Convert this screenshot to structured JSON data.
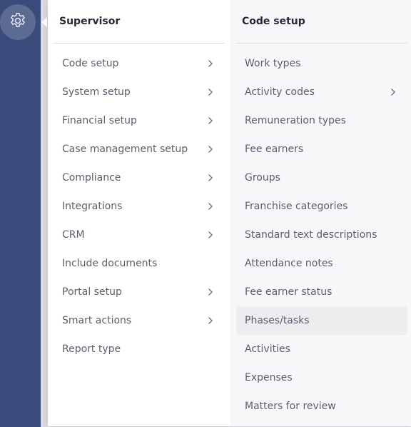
{
  "sidebar": {
    "settings_icon": "gear-icon"
  },
  "left_column": {
    "title": "Supervisor",
    "items": [
      {
        "label": "Code setup",
        "has_submenu": true
      },
      {
        "label": "System setup",
        "has_submenu": true
      },
      {
        "label": "Financial setup",
        "has_submenu": true
      },
      {
        "label": "Case management setup",
        "has_submenu": true
      },
      {
        "label": "Compliance",
        "has_submenu": true
      },
      {
        "label": "Integrations",
        "has_submenu": true
      },
      {
        "label": "CRM",
        "has_submenu": true
      },
      {
        "label": "Include documents",
        "has_submenu": false
      },
      {
        "label": "Portal setup",
        "has_submenu": true
      },
      {
        "label": "Smart actions",
        "has_submenu": true
      },
      {
        "label": "Report type",
        "has_submenu": false
      }
    ]
  },
  "right_column": {
    "title": "Code setup",
    "items": [
      {
        "label": "Work types",
        "has_submenu": false
      },
      {
        "label": "Activity codes",
        "has_submenu": true
      },
      {
        "label": "Remuneration types",
        "has_submenu": false
      },
      {
        "label": "Fee earners",
        "has_submenu": false
      },
      {
        "label": "Groups",
        "has_submenu": false
      },
      {
        "label": "Franchise categories",
        "has_submenu": false
      },
      {
        "label": "Standard text descriptions",
        "has_submenu": false
      },
      {
        "label": "Attendance notes",
        "has_submenu": false
      },
      {
        "label": "Fee earner status",
        "has_submenu": false
      },
      {
        "label": "Phases/tasks",
        "has_submenu": false,
        "hovered": true
      },
      {
        "label": "Activities",
        "has_submenu": false
      },
      {
        "label": "Expenses",
        "has_submenu": false
      },
      {
        "label": "Matters for review",
        "has_submenu": false
      }
    ]
  },
  "colors": {
    "sidebar": "#3a4a7a",
    "gear_bg": "#5c6b92",
    "text": "#5a5f6e",
    "title": "#252a36",
    "hover": "#ededf0"
  }
}
